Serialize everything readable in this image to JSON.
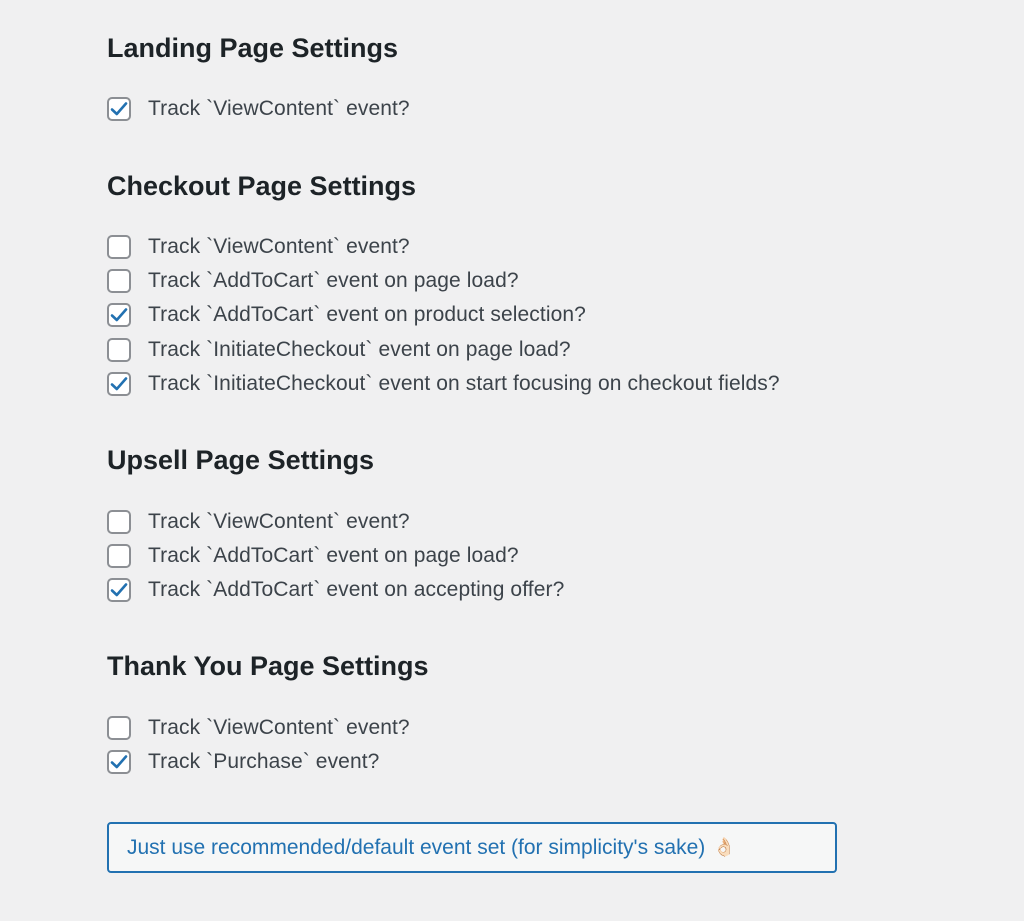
{
  "sections": [
    {
      "title": "Landing Page Settings",
      "options": [
        {
          "label": "Track `ViewContent` event?",
          "checked": true
        }
      ]
    },
    {
      "title": "Checkout Page Settings",
      "options": [
        {
          "label": "Track `ViewContent` event?",
          "checked": false
        },
        {
          "label": "Track `AddToCart` event on page load?",
          "checked": false
        },
        {
          "label": "Track `AddToCart` event on product selection?",
          "checked": true
        },
        {
          "label": "Track `InitiateCheckout` event on page load?",
          "checked": false
        },
        {
          "label": "Track `InitiateCheckout` event on start focusing on checkout fields?",
          "checked": true
        }
      ]
    },
    {
      "title": "Upsell Page Settings",
      "options": [
        {
          "label": "Track `ViewContent` event?",
          "checked": false
        },
        {
          "label": "Track `AddToCart` event on page load?",
          "checked": false
        },
        {
          "label": "Track `AddToCart` event on accepting offer?",
          "checked": true
        }
      ]
    },
    {
      "title": "Thank You Page Settings",
      "options": [
        {
          "label": "Track `ViewContent` event?",
          "checked": false
        },
        {
          "label": "Track `Purchase` event?",
          "checked": true
        }
      ]
    }
  ],
  "button": {
    "label": "Just use recommended/default event set (for simplicity's sake)",
    "emoji": "👌🏻"
  },
  "colors": {
    "background": "#f0f0f1",
    "heading": "#1d2327",
    "text": "#3c434a",
    "accent": "#2271b1",
    "checkbox_border": "#8c8f94"
  }
}
